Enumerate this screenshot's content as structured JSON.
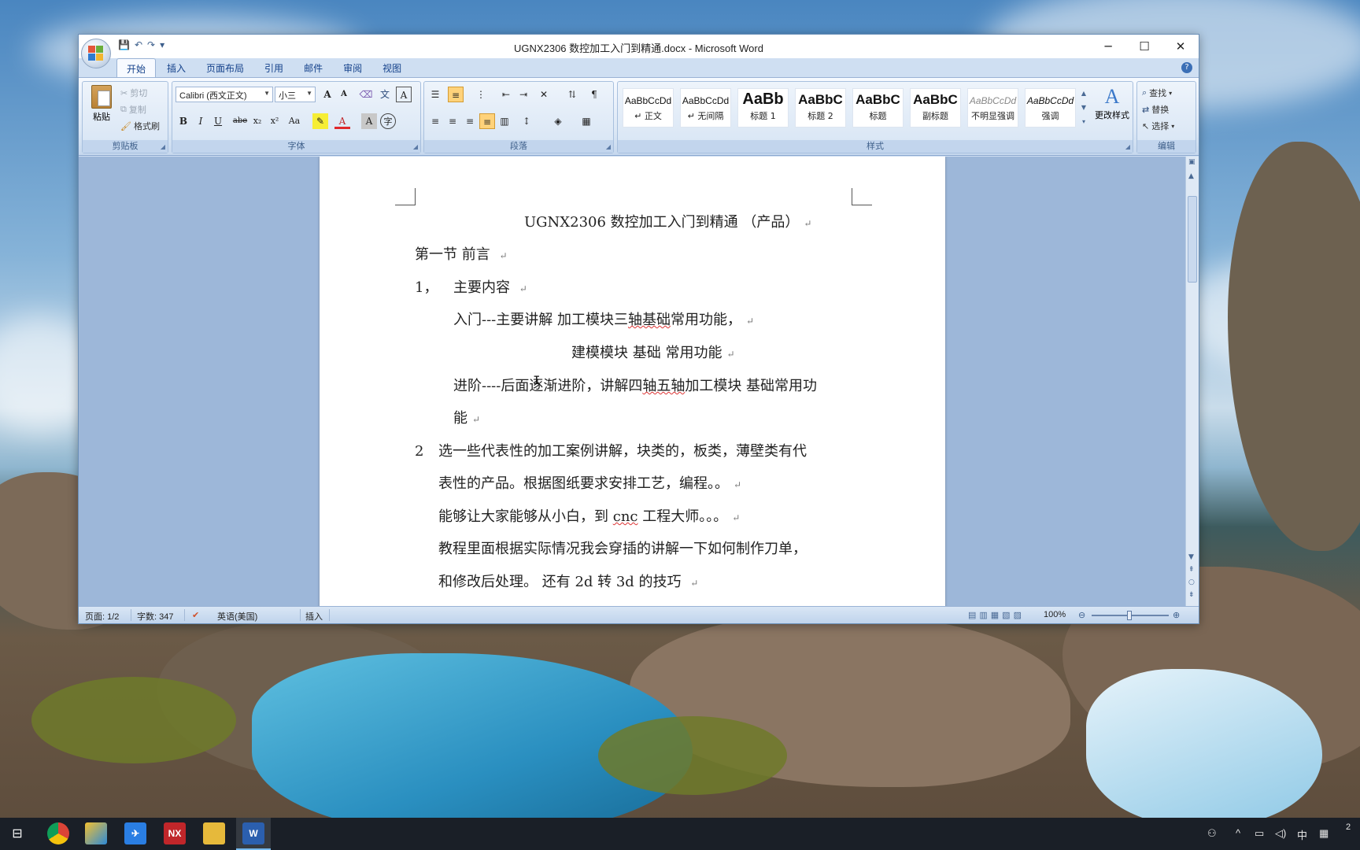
{
  "window": {
    "title": "UGNX2306 数控加工入门到精通.docx - Microsoft Word",
    "controls": {
      "minimize": "─",
      "maximize": "☐",
      "close": "✕"
    }
  },
  "quick_access": {
    "save": "💾",
    "undo": "↶",
    "redo": "↷",
    "customize": "▾"
  },
  "tabs": [
    "开始",
    "插入",
    "页面布局",
    "引用",
    "邮件",
    "审阅",
    "视图"
  ],
  "ribbon": {
    "clipboard": {
      "label": "剪贴板",
      "paste": "粘贴",
      "cut": "剪切",
      "copy": "复制",
      "format_painter": "格式刷"
    },
    "font": {
      "label": "字体",
      "font_name": "Calibri (西文正文)",
      "font_size": "小三",
      "grow": "A",
      "shrink": "A",
      "bold": "B",
      "italic": "I",
      "underline": "U",
      "strike": "abe",
      "subscript": "x₂",
      "superscript": "x²",
      "change_case": "Aa",
      "font_color": "A",
      "char_shading": "A",
      "enclose": "字"
    },
    "paragraph": {
      "label": "段落"
    },
    "styles": {
      "label": "样式",
      "items": [
        {
          "sample": "AaBbCcDd",
          "name": "↵ 正文"
        },
        {
          "sample": "AaBbCcDd",
          "name": "↵ 无间隔"
        },
        {
          "sample": "AaBb",
          "name": "标题 1"
        },
        {
          "sample": "AaBbC",
          "name": "标题 2"
        },
        {
          "sample": "AaBbC",
          "name": "标题"
        },
        {
          "sample": "AaBbC",
          "name": "副标题"
        },
        {
          "sample": "AaBbCcDd",
          "name": "不明显强调"
        },
        {
          "sample": "AaBbCcDd",
          "name": "强调"
        }
      ],
      "change_styles": "更改样式"
    },
    "editing": {
      "label": "编辑",
      "find": "查找",
      "replace": "替换",
      "select": "选择"
    }
  },
  "document": {
    "lines": [
      {
        "text": "UGNX2306  数控加工入门到精通   （产品）"
      },
      {
        "text": "第一节  前言    "
      },
      {
        "num": "1，",
        "text": "主要内容 "
      },
      {
        "text_a": "入门---主要讲解  加工模块三",
        "squig": "轴基础",
        "text_b": "常用功能，"
      },
      {
        "text": "建模模块  基础  常用功能"
      },
      {
        "text_a": "进阶----后面逐渐进阶，讲解四",
        "squig": "轴五轴",
        "text_b": "加工模块  基础常用功"
      },
      {
        "text": "能"
      },
      {
        "num": "2",
        "text": "选一些代表性的加工案例讲解，块类的，板类，薄壁类有代"
      },
      {
        "text": "表性的产品。根据图纸要求安排工艺，编程。。"
      },
      {
        "text_a": "能够让大家能够从小白，到 ",
        "squig": "cnc",
        "text_b": " 工程大师。。。"
      },
      {
        "text": "教程里面根据实际情况我会穿插的讲解一下如何制作刀单，"
      },
      {
        "text": "和修改后处理。  还有 2d 转 3d 的技巧   "
      }
    ],
    "para_mark": "↵"
  },
  "status": {
    "page": "页面: 1/2",
    "words": "字数: 347",
    "language": "英语(美国)",
    "mode": "插入",
    "zoom": "100%",
    "zoom_level": 0.5
  },
  "taskbar": {
    "apps": [
      "task-view",
      "chrome",
      "paint",
      "feishu",
      "NX",
      "explorer",
      "word"
    ],
    "nx_label": "NX",
    "word_label": "W",
    "tray": {
      "ime": "中",
      "clock_partial": "2"
    }
  },
  "colors": {
    "ribbon_blue": "#dbe7f5",
    "tab_text": "#15428b",
    "doc_bg": "#9db7d9",
    "taskbar": "#1a1f27"
  }
}
